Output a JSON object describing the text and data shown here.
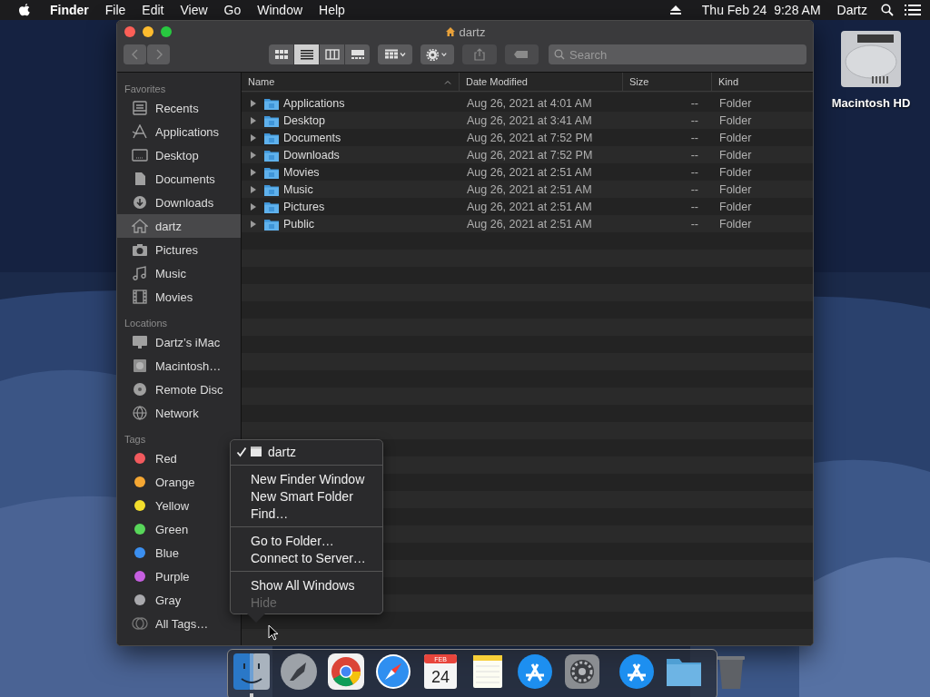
{
  "menu_bar": {
    "app": "Finder",
    "items": [
      "File",
      "Edit",
      "View",
      "Go",
      "Window",
      "Help"
    ],
    "clock": "Thu Feb 24  9:28 AM",
    "user": "Dartz"
  },
  "window": {
    "title": "dartz",
    "view_modes": [
      {
        "selected": false
      },
      {
        "selected": true
      },
      {
        "selected": false
      },
      {
        "selected": false
      }
    ],
    "search": {
      "placeholder": "Search"
    },
    "sidebar": [
      {
        "heading": "Favorites",
        "items": [
          {
            "label": "Recents",
            "kind": "place",
            "selected": false
          },
          {
            "label": "Applications",
            "kind": "place",
            "selected": false
          },
          {
            "label": "Desktop",
            "kind": "place",
            "selected": false
          },
          {
            "label": "Documents",
            "kind": "place",
            "selected": false
          },
          {
            "label": "Downloads",
            "kind": "place",
            "selected": false
          },
          {
            "label": "dartz",
            "kind": "place",
            "selected": true
          },
          {
            "label": "Pictures",
            "kind": "place",
            "selected": false
          },
          {
            "label": "Music",
            "kind": "place",
            "selected": false
          },
          {
            "label": "Movies",
            "kind": "place",
            "selected": false
          }
        ]
      },
      {
        "heading": "Locations",
        "items": [
          {
            "label": "Dartz’s iMac",
            "kind": "place",
            "selected": false
          },
          {
            "label": "Macintosh…",
            "kind": "place",
            "selected": false
          },
          {
            "label": "Remote Disc",
            "kind": "place",
            "selected": false
          },
          {
            "label": "Network",
            "kind": "place",
            "selected": false
          }
        ]
      },
      {
        "heading": "Tags",
        "items": [
          {
            "label": "Red",
            "kind": "tag",
            "color": "#f25a5e",
            "selected": false
          },
          {
            "label": "Orange",
            "kind": "tag",
            "color": "#f5a733",
            "selected": false
          },
          {
            "label": "Yellow",
            "kind": "tag",
            "color": "#f3de2c",
            "selected": false
          },
          {
            "label": "Green",
            "kind": "tag",
            "color": "#58d65a",
            "selected": false
          },
          {
            "label": "Blue",
            "kind": "tag",
            "color": "#3b8ff0",
            "selected": false
          },
          {
            "label": "Purple",
            "kind": "tag",
            "color": "#c65fe0",
            "selected": false
          },
          {
            "label": "Gray",
            "kind": "tag",
            "color": "#a9a9ad",
            "selected": false
          },
          {
            "label": "All Tags…",
            "kind": "all-tags",
            "selected": false
          }
        ]
      }
    ],
    "table": {
      "columns": [
        {
          "label": "Name",
          "sorted": true
        },
        {
          "label": "Date Modified",
          "sorted": false
        },
        {
          "label": "Size",
          "sorted": false
        },
        {
          "label": "Kind",
          "sorted": false
        }
      ],
      "rows": [
        {
          "name": "Applications",
          "date": "Aug 26, 2021 at 4:01 AM",
          "size": "--",
          "kind": "Folder",
          "expanded": false
        },
        {
          "name": "Desktop",
          "date": "Aug 26, 2021 at 3:41 AM",
          "size": "--",
          "kind": "Folder",
          "expanded": false
        },
        {
          "name": "Documents",
          "date": "Aug 26, 2021 at 7:52 PM",
          "size": "--",
          "kind": "Folder",
          "expanded": false
        },
        {
          "name": "Downloads",
          "date": "Aug 26, 2021 at 7:52 PM",
          "size": "--",
          "kind": "Folder",
          "expanded": false
        },
        {
          "name": "Movies",
          "date": "Aug 26, 2021 at 2:51 AM",
          "size": "--",
          "kind": "Folder",
          "expanded": false
        },
        {
          "name": "Music",
          "date": "Aug 26, 2021 at 2:51 AM",
          "size": "--",
          "kind": "Folder",
          "expanded": false
        },
        {
          "name": "Pictures",
          "date": "Aug 26, 2021 at 2:51 AM",
          "size": "--",
          "kind": "Folder",
          "expanded": false
        },
        {
          "name": "Public",
          "date": "Aug 26, 2021 at 2:51 AM",
          "size": "--",
          "kind": "Folder",
          "expanded": false
        }
      ]
    }
  },
  "context_menu": {
    "sections": [
      [
        {
          "label": "dartz",
          "kind": "window",
          "checked": true,
          "disabled": false
        }
      ],
      [
        {
          "label": "New Finder Window",
          "kind": "command",
          "checked": false,
          "disabled": false
        },
        {
          "label": "New Smart Folder",
          "kind": "command",
          "checked": false,
          "disabled": false
        },
        {
          "label": "Find…",
          "kind": "command",
          "checked": false,
          "disabled": false
        }
      ],
      [
        {
          "label": "Go to Folder…",
          "kind": "command",
          "checked": false,
          "disabled": false
        },
        {
          "label": "Connect to Server…",
          "kind": "command",
          "checked": false,
          "disabled": false
        }
      ],
      [
        {
          "label": "Show All Windows",
          "kind": "command",
          "checked": false,
          "disabled": false
        },
        {
          "label": "Hide",
          "kind": "command",
          "checked": false,
          "disabled": true
        }
      ]
    ]
  },
  "desktop_icons": [
    {
      "label": "Macintosh HD"
    }
  ],
  "dock": {
    "items": [
      {
        "kind": "finder",
        "running": true
      },
      {
        "kind": "launchpad",
        "running": false
      },
      {
        "kind": "chrome",
        "running": false
      },
      {
        "kind": "safari",
        "running": false
      },
      {
        "kind": "calendar",
        "running": false,
        "month": "FEB",
        "day": "24"
      },
      {
        "kind": "notes",
        "running": false
      },
      {
        "kind": "appstore",
        "running": false
      },
      {
        "kind": "preferences",
        "running": false
      },
      {
        "kind": "divider"
      },
      {
        "kind": "appstore",
        "running": false
      },
      {
        "kind": "folder",
        "running": false
      },
      {
        "kind": "trash",
        "running": false
      }
    ]
  }
}
